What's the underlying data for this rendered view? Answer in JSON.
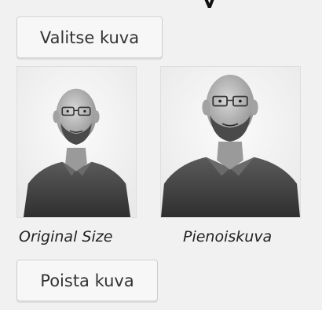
{
  "heading_fragment": "y",
  "buttons": {
    "select_image": "Valitse kuva",
    "remove_image": "Poista kuva"
  },
  "captions": {
    "original": "Original Size",
    "thumbnail": "Pienoiskuva"
  },
  "colors": {
    "background": "#f1f1f1",
    "button_bg": "#f7f7f7",
    "button_border": "#cccccc",
    "text": "#333333"
  }
}
